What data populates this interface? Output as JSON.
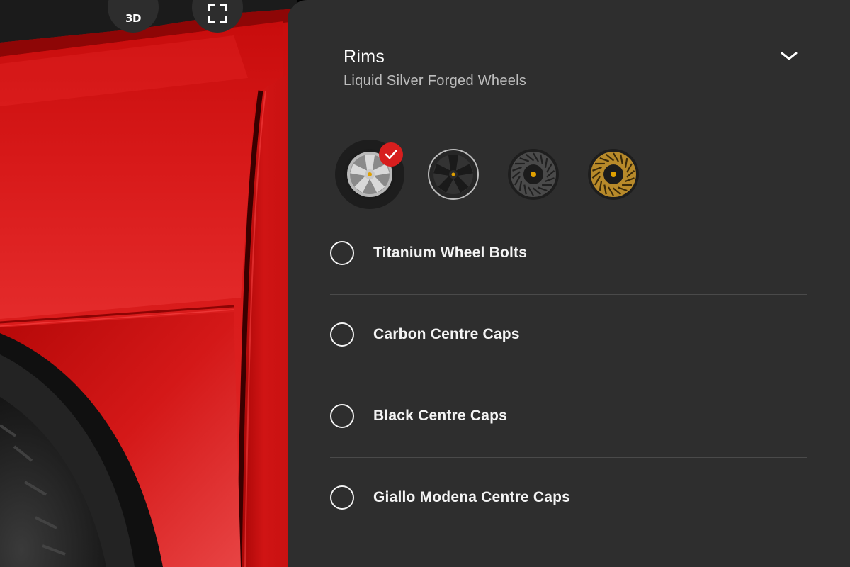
{
  "viewer": {
    "view_3d_label": "3D",
    "body_color": "#d41414"
  },
  "panel": {
    "title": "Rims",
    "subtitle": "Liquid Silver Forged Wheels",
    "background": "#2e2e2e"
  },
  "wheel_swatches": [
    {
      "icon": "silver-forged-wheel-icon",
      "selected": true
    },
    {
      "icon": "black-forged-wheel-icon",
      "selected": false
    },
    {
      "icon": "black-turbine-wheel-icon",
      "selected": false
    },
    {
      "icon": "gold-turbine-wheel-icon",
      "selected": false
    }
  ],
  "options": [
    {
      "label": "Titanium Wheel Bolts",
      "selected": false
    },
    {
      "label": "Carbon Centre Caps",
      "selected": false
    },
    {
      "label": "Black Centre Caps",
      "selected": false
    },
    {
      "label": "Giallo Modena Centre Caps",
      "selected": false
    }
  ],
  "accent_color": "#d71e1e"
}
